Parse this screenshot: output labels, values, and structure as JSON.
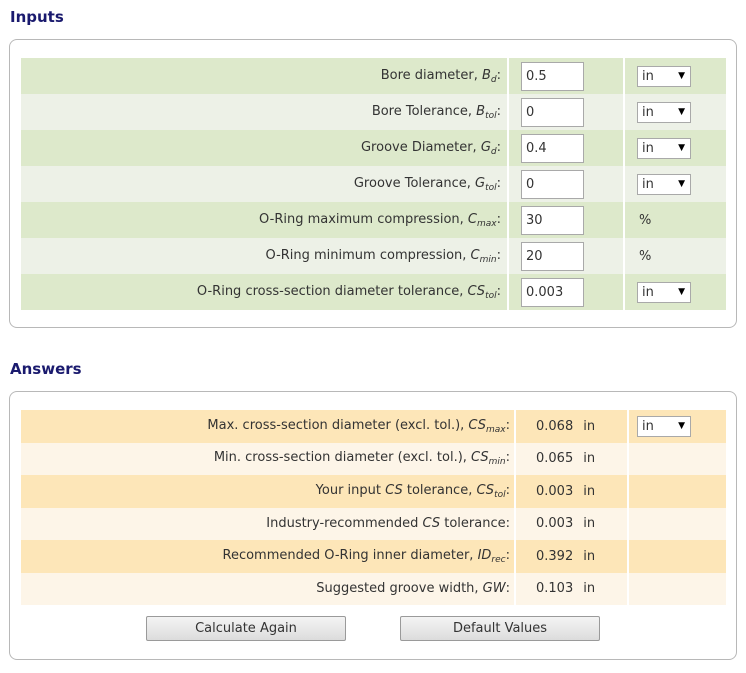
{
  "inputs": {
    "title": "Inputs",
    "rows": [
      {
        "label": "Bore diameter, ",
        "var": "B",
        "sub": "d",
        "value": "0.5",
        "unit": "in"
      },
      {
        "label": "Bore Tolerance, ",
        "var": "B",
        "sub": "tol",
        "value": "0",
        "unit": "in"
      },
      {
        "label": "Groove Diameter, ",
        "var": "G",
        "sub": "d",
        "value": "0.4",
        "unit": "in"
      },
      {
        "label": "Groove Tolerance, ",
        "var": "G",
        "sub": "tol",
        "value": "0",
        "unit": "in"
      },
      {
        "label": "O-Ring maximum compression, ",
        "var": "C",
        "sub": "max",
        "value": "30",
        "unit": "%"
      },
      {
        "label": "O-Ring minimum compression, ",
        "var": "C",
        "sub": "min",
        "value": "20",
        "unit": "%"
      },
      {
        "label": "O-Ring cross-section diameter tolerance, ",
        "var": "CS",
        "sub": "tol",
        "value": "0.003",
        "unit": "in"
      }
    ]
  },
  "answers": {
    "title": "Answers",
    "rows": [
      {
        "label": "Max. cross-section diameter (excl. tol.), ",
        "var": "CS",
        "sub": "max",
        "value": "0.068",
        "unit": "in",
        "select": "in"
      },
      {
        "label": "Min. cross-section diameter (excl. tol.), ",
        "var": "CS",
        "sub": "min",
        "value": "0.065",
        "unit": "in"
      },
      {
        "label_pre": "Your input ",
        "label_mid": "CS",
        "label": " tolerance, ",
        "var": "CS",
        "sub": "tol",
        "value": "0.003",
        "unit": "in"
      },
      {
        "label_pre": "Industry-recommended ",
        "label_mid": "CS",
        "label": " tolerance:",
        "value": "0.003",
        "unit": "in"
      },
      {
        "label": "Recommended O-Ring inner diameter, ",
        "var": "ID",
        "sub": "rec",
        "value": "0.392",
        "unit": "in"
      },
      {
        "label": "Suggested groove width, ",
        "var": "GW",
        "value": "0.103",
        "unit": "in"
      }
    ]
  },
  "buttons": {
    "calculate": "Calculate Again",
    "defaults": "Default Values"
  },
  "colon": ":",
  "arrow": "▼"
}
